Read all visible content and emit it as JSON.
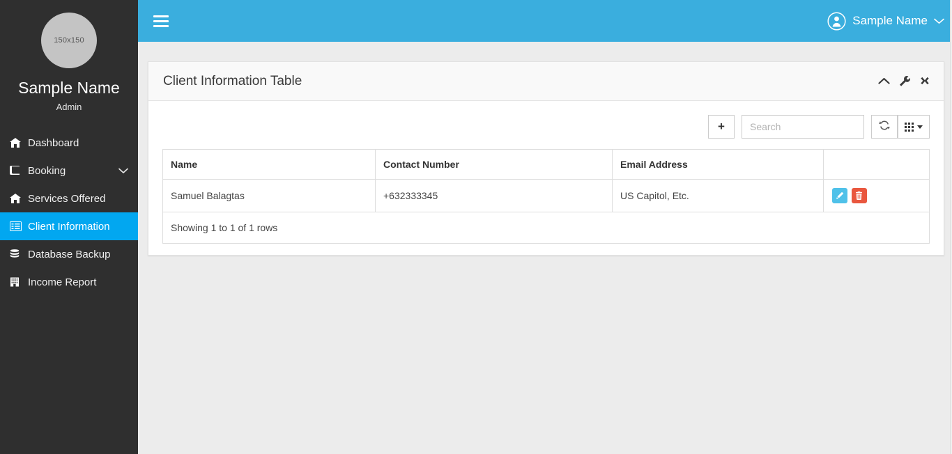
{
  "sidebar": {
    "avatar_label": "150x150",
    "profile_name": "Sample Name",
    "profile_role": "Admin",
    "items": [
      {
        "label": "Dashboard",
        "icon": "home-icon",
        "active": false,
        "caret": false
      },
      {
        "label": "Booking",
        "icon": "book-icon",
        "active": false,
        "caret": true
      },
      {
        "label": "Services Offered",
        "icon": "home-icon",
        "active": false,
        "caret": false
      },
      {
        "label": "Client Information",
        "icon": "list-alt-icon",
        "active": true,
        "caret": false
      },
      {
        "label": "Database Backup",
        "icon": "database-icon",
        "active": false,
        "caret": false
      },
      {
        "label": "Income Report",
        "icon": "building-icon",
        "active": false,
        "caret": false
      }
    ]
  },
  "topbar": {
    "menu_icon": "hamburger-icon",
    "user_icon": "user-circle-icon",
    "user_name": "Sample Name",
    "caret_icon": "chevron-down-icon"
  },
  "panel": {
    "title": "Client Information Table",
    "tools": [
      {
        "name": "collapse-icon",
        "glyph": "chevron-up"
      },
      {
        "name": "wrench-icon",
        "glyph": "wrench"
      },
      {
        "name": "close-icon",
        "glyph": "times"
      }
    ]
  },
  "toolbar": {
    "add_label": "+",
    "search_placeholder": "Search",
    "search_value": "",
    "refresh_icon": "refresh-icon",
    "columns_icon": "grid-icon"
  },
  "table": {
    "columns": [
      "Name",
      "Contact Number",
      "Email Address",
      ""
    ],
    "rows": [
      {
        "name": "Samuel Balagtas",
        "contact": "+632333345",
        "email": "US Capitol, Etc.",
        "actions": [
          {
            "name": "edit-row-button",
            "icon": "pencil-icon",
            "color": "#4fc1e9"
          },
          {
            "name": "delete-row-button",
            "icon": "trash-icon",
            "color": "#e9573f"
          }
        ]
      }
    ],
    "footer": "Showing 1 to 1 of 1 rows"
  },
  "colors": {
    "topbar_blue": "#3aaede",
    "active_blue": "#02a7f0",
    "sidebar_dark": "#2f2f2f",
    "page_bg": "#ececec",
    "edit_blue": "#4fc1e9",
    "delete_red": "#e9573f"
  }
}
